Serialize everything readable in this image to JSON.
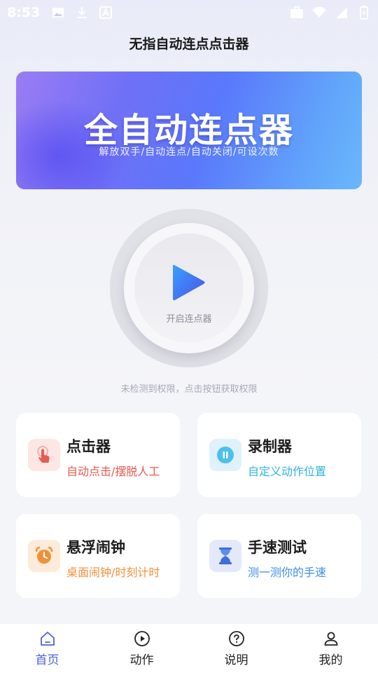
{
  "status_bar": {
    "time": "8:53"
  },
  "app_title": "无指自动连点点击器",
  "banner": {
    "title": "全自动连点器",
    "subtitle": "解放双手/自动连点/自动关闭/可设次数"
  },
  "start_button": {
    "label": "开启连点器"
  },
  "permission_hint": "未检测到权限，点击按钮获取权限",
  "cards": [
    {
      "title": "点击器",
      "desc": "自动点击/摆脱人工",
      "icon": "tap-finger-icon",
      "color": "#e85a4f"
    },
    {
      "title": "录制器",
      "desc": "自定义动作位置",
      "icon": "pause-circle-icon",
      "color": "#2fb4e3"
    },
    {
      "title": "悬浮闹钟",
      "desc": "桌面闹钟/时刻计时",
      "icon": "alarm-clock-icon",
      "color": "#f0913a"
    },
    {
      "title": "手速测试",
      "desc": "测一测你的手速",
      "icon": "hourglass-icon",
      "color": "#3d8fe6"
    }
  ],
  "tabs": [
    {
      "label": "首页",
      "icon": "home-icon",
      "active": true
    },
    {
      "label": "动作",
      "icon": "play-circle-icon",
      "active": false
    },
    {
      "label": "说明",
      "icon": "help-circle-icon",
      "active": false
    },
    {
      "label": "我的",
      "icon": "user-icon",
      "active": false
    }
  ],
  "colors": {
    "accent": "#4a63d8"
  }
}
